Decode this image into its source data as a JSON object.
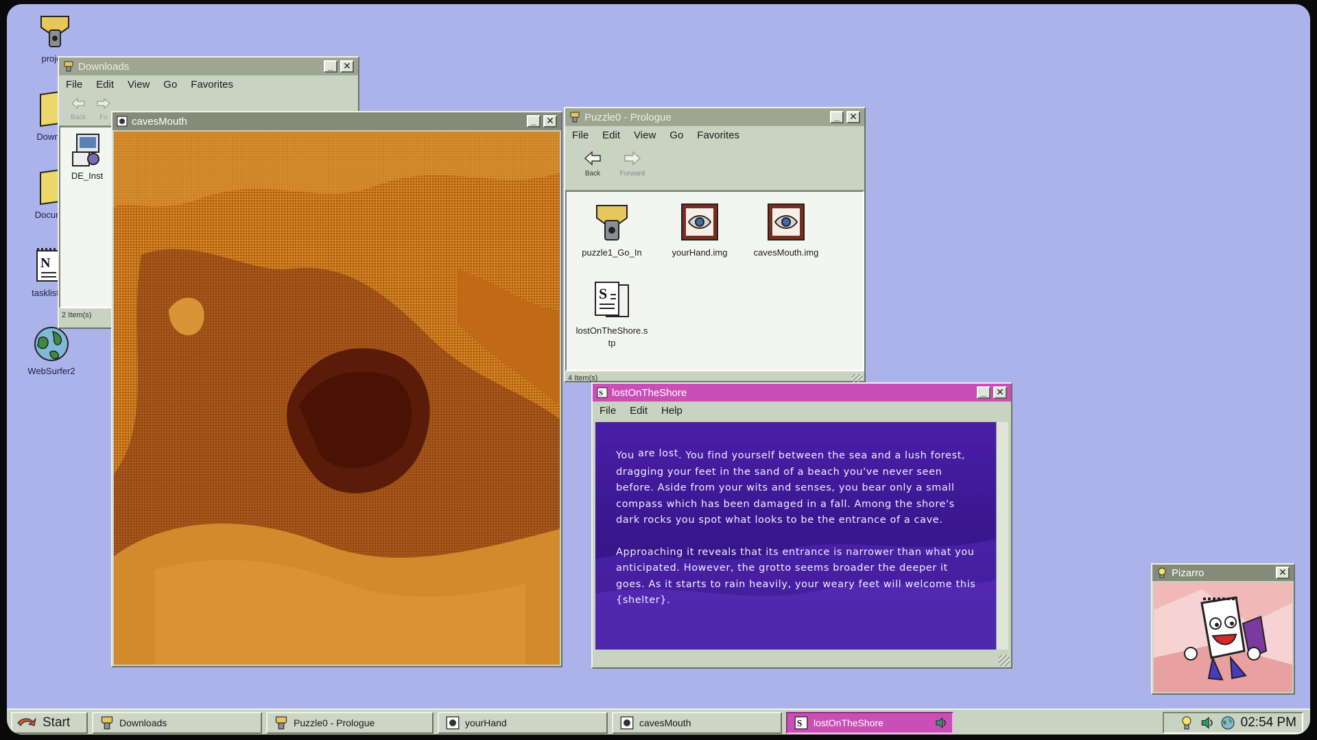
{
  "desktop_icons": [
    {
      "label": "project",
      "icon": "vault-icon"
    },
    {
      "label": "Downlo",
      "icon": "folder-icon"
    },
    {
      "label": "Docume",
      "icon": "folder-icon"
    },
    {
      "label": "tasklist.r",
      "icon": "notepad-icon"
    },
    {
      "label": "WebSurfer2",
      "icon": "globe-icon"
    }
  ],
  "downloads_window": {
    "title": "Downloads",
    "menu": [
      "File",
      "Edit",
      "View",
      "Go",
      "Favorites"
    ],
    "nav": {
      "back": "Back",
      "forward": "Fo"
    },
    "files": [
      {
        "label": "DE_Inst",
        "icon": "installer-icon"
      }
    ],
    "status": "2 Item(s)"
  },
  "caves_window": {
    "title": "cavesMouth",
    "image_icon": "image-icon"
  },
  "prologue_window": {
    "title": "Puzzle0 - Prologue",
    "menu": [
      "File",
      "Edit",
      "View",
      "Go",
      "Favorites"
    ],
    "nav": {
      "back": "Back",
      "forward": "Forward"
    },
    "files": [
      {
        "label": "puzzle1_Go_In",
        "icon": "vault-icon"
      },
      {
        "label": "yourHand.img",
        "icon": "image-file-icon"
      },
      {
        "label": "cavesMouth.img",
        "icon": "image-file-icon"
      },
      {
        "label": "lostOnTheShore.s",
        "label2": "tp",
        "icon": "story-file-icon"
      }
    ],
    "status": "4 Item(s)"
  },
  "story_window": {
    "title": "lostOnTheShore",
    "menu": [
      "File",
      "Edit",
      "Help"
    ],
    "para1_first": "You ",
    "para1_are": "are lost",
    "para1_rest": ". You find yourself between the sea and a lush forest, dragging your feet in the sand of a beach you've never seen before. Aside from your wits and senses, you bear only a small compass which has been damaged in a fall. Among the shore's dark rocks you spot what looks to be the entrance of a cave.",
    "para2": "Approaching it reveals that its entrance is narrower than what you anticipated. However, the grotto seems broader the deeper it goes. As it starts to rain heavily, your weary feet will welcome this {shelter}."
  },
  "pizarro_window": {
    "title": "Pizarro"
  },
  "taskbar": {
    "start": "Start",
    "items": [
      {
        "label": "Downloads",
        "icon": "vault-icon"
      },
      {
        "label": "Puzzle0 - Prologue",
        "icon": "vault-icon"
      },
      {
        "label": "yourHand",
        "icon": "image-icon"
      },
      {
        "label": "cavesMouth",
        "icon": "image-icon"
      },
      {
        "label": "lostOnTheShore",
        "icon": "story-file-icon"
      }
    ],
    "clock": "02:54 PM"
  },
  "colors": {
    "desktop": "#abb3ea",
    "window_chrome": "#c9d3c1",
    "active_accent": "#c94fb6",
    "story_bg": "#3a1a8a",
    "cave_orange": "#c8761a"
  }
}
